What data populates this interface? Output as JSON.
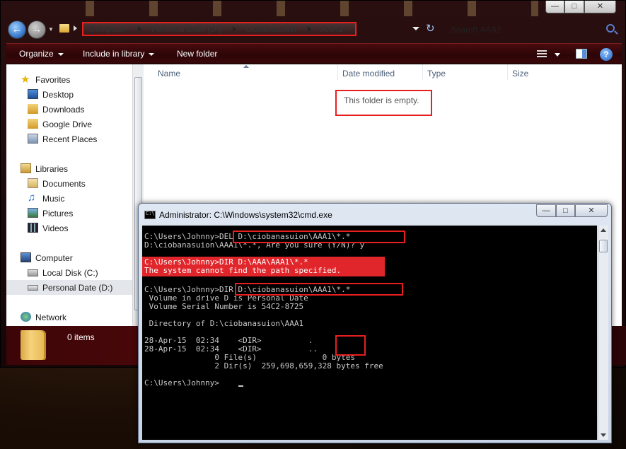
{
  "explorer": {
    "breadcrumb": [
      "Computer",
      "Personal Date (D:)",
      "ciobanasuion",
      "AAA1"
    ],
    "search_placeholder": "Search AAA1",
    "toolbar": {
      "organize": "Organize",
      "include_in_library": "Include in library",
      "new_folder": "New folder"
    },
    "nav": {
      "favorites": "Favorites",
      "desktop": "Desktop",
      "downloads": "Downloads",
      "google_drive": "Google Drive",
      "recent_places": "Recent Places",
      "libraries": "Libraries",
      "documents": "Documents",
      "music": "Music",
      "pictures": "Pictures",
      "videos": "Videos",
      "computer": "Computer",
      "local_disk": "Local Disk (C:)",
      "personal_date": "Personal Date (D:)",
      "network": "Network"
    },
    "columns": [
      "Name",
      "Date modified",
      "Type",
      "Size"
    ],
    "empty_message": "This folder is empty.",
    "item_count": "0 items"
  },
  "cmd": {
    "title": "Administrator: C:\\Windows\\system32\\cmd.exe",
    "lines": [
      "C:\\Users\\Johnny>DEL D:\\ciobanasuion\\AAA1\\*.*",
      "D:\\ciobanasuion\\AAA1\\*.*, Are you sure (Y/N)? y",
      "",
      "C:\\Users\\Johnny>DIR D:\\AAA\\AAA1\\*.*",
      "The system cannot find the path specified.",
      "",
      "C:\\Users\\Johnny>DIR D:\\ciobanasuion\\AAA1\\*.*",
      " Volume in drive D is Personal Date",
      " Volume Serial Number is 54C2-8725",
      "",
      " Directory of D:\\ciobanasuion\\AAA1",
      "",
      "28-Apr-15  02:34    <DIR>          .",
      "28-Apr-15  02:34    <DIR>          ..",
      "               0 File(s)              0 bytes",
      "               2 Dir(s)  259,698,659,328 bytes free",
      "",
      "C:\\Users\\Johnny>"
    ]
  },
  "colors": {
    "highlight_red": "#e81f1f",
    "console_bg": "#000000",
    "console_text": "#c8c8c8",
    "toolbar_red": "#4a0b0e"
  }
}
